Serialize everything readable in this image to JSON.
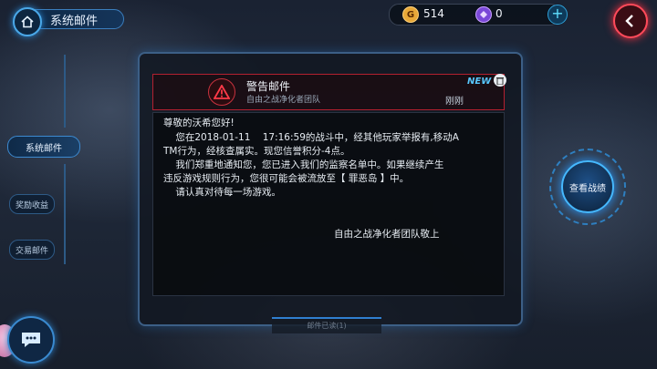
{
  "header": {
    "title": "系统邮件"
  },
  "currency": {
    "gold": "514",
    "gems": "0",
    "gold_glyph": "G"
  },
  "nav": {
    "active": "系统邮件",
    "rewards": "奖励收益",
    "trade": "交易邮件"
  },
  "mail": {
    "type": "警告邮件",
    "sender": "自由之战净化者团队",
    "time": "刚刚",
    "new_badge": "NEW",
    "lines": [
      "尊敬的沃希您好!",
      "    您在2018-01-11    17:16:59的战斗中，经其他玩家举报有,移动A",
      "TM行为，经核查属实。现您信誉积分-4点。",
      "    我们郑重地通知您，您已进入我们的监察名单中。如果继续产生",
      "违反游戏规则行为，您很可能会被流放至【 罪恶岛 】中。",
      "    请认真对待每一场游戏。"
    ],
    "signature": "自由之战净化者团队敬上"
  },
  "bottom_tab": "邮件已读(1)",
  "view_record_button": "查看战绩",
  "colors": {
    "accent": "#45b8ff",
    "warning": "#c8323e",
    "new_badge": "#58c8ff"
  }
}
